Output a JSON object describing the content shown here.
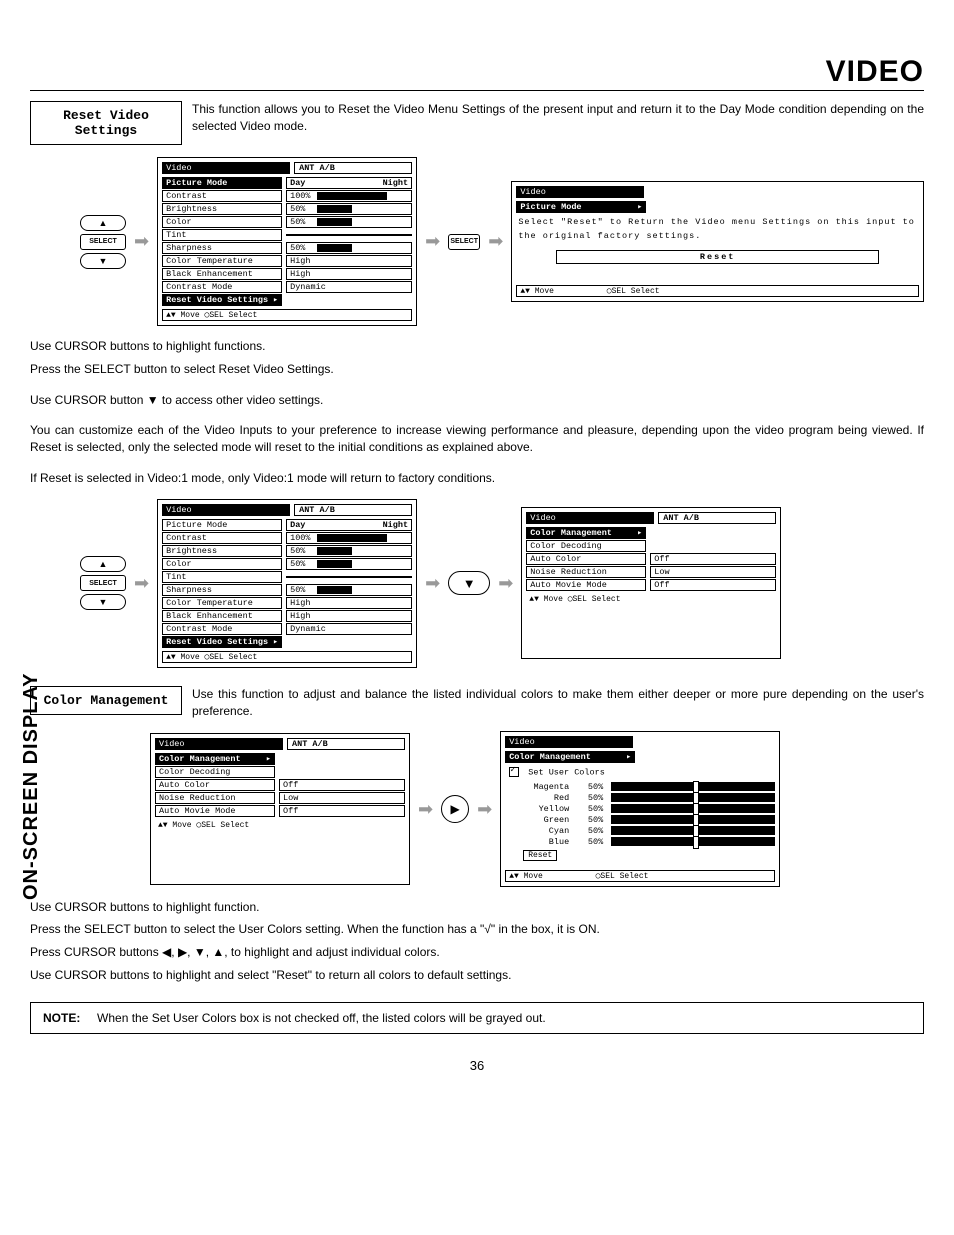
{
  "page": {
    "title": "VIDEO",
    "sidebar": "ON-SCREEN DISPLAY",
    "number": "36"
  },
  "reset": {
    "box_title": "Reset Video\nSettings",
    "desc": "This function allows you to Reset the Video Menu Settings of the present input and return it to the Day Mode condition depending on the selected Video mode.",
    "para1": "Use CURSOR buttons to highlight functions.",
    "para2": "Press the SELECT button to select Reset Video Settings.",
    "para3": "Use CURSOR button ▼ to access other video settings.",
    "para4": "You can customize each of the Video Inputs to your preference to increase viewing performance and pleasure, depending upon the video program being viewed. If Reset is selected, only the selected mode will reset to the initial conditions as explained above.",
    "para5": "If Reset is selected in Video:1 mode, only Video:1 mode will return to factory conditions."
  },
  "colormgmt": {
    "box_title": "Color Management",
    "desc": "Use this function to adjust and balance the listed individual colors to make them either deeper or more pure depending on the user's preference.",
    "para1": "Use CURSOR buttons to highlight function.",
    "para2": "Press the SELECT button to select the User Colors setting.  When the function has a \"√\" in the box, it is ON.",
    "para3": "Press CURSOR buttons ◀, ▶, ▼, ▲, to highlight and adjust individual colors.",
    "para4": "Use CURSOR buttons to highlight and select \"Reset\" to return all colors to default settings."
  },
  "note": {
    "label": "NOTE:",
    "text": "When the Set User Colors box is not checked off, the listed colors will be grayed out."
  },
  "osd": {
    "video_title": "Video",
    "ant": "ANT A/B",
    "picture_mode": "Picture Mode",
    "day": "Day",
    "night": "Night",
    "contrast": "Contrast",
    "brightness": "Brightness",
    "color": "Color",
    "tint": "Tint",
    "sharpness": "Sharpness",
    "color_temp": "Color Temperature",
    "black_enh": "Black Enhancement",
    "contrast_mode": "Contrast Mode",
    "reset_video": "Reset Video Settings",
    "footer": "▲▼ Move  ◯SEL Select",
    "footer_move": "▲▼ Move",
    "footer_sel": "◯SEL Select",
    "val_100": "100%",
    "val_50": "50%",
    "val_high": "High",
    "val_dynamic": "Dynamic",
    "reset_msg": "Select \"Reset\" to Return the Video menu Settings on this input to the original factory settings.",
    "reset_btn": "Reset",
    "color_mgmt": "Color Management",
    "color_decoding": "Color Decoding",
    "auto_color": "Auto Color",
    "noise_red": "Noise Reduction",
    "auto_movie": "Auto Movie Mode",
    "val_off": "Off",
    "val_low": "Low",
    "set_user_colors": "Set User Colors",
    "magenta": "Magenta",
    "red": "Red",
    "yellow": "Yellow",
    "green": "Green",
    "cyan": "Cyan",
    "blue": "Blue"
  },
  "remote": {
    "select": "SELECT"
  }
}
